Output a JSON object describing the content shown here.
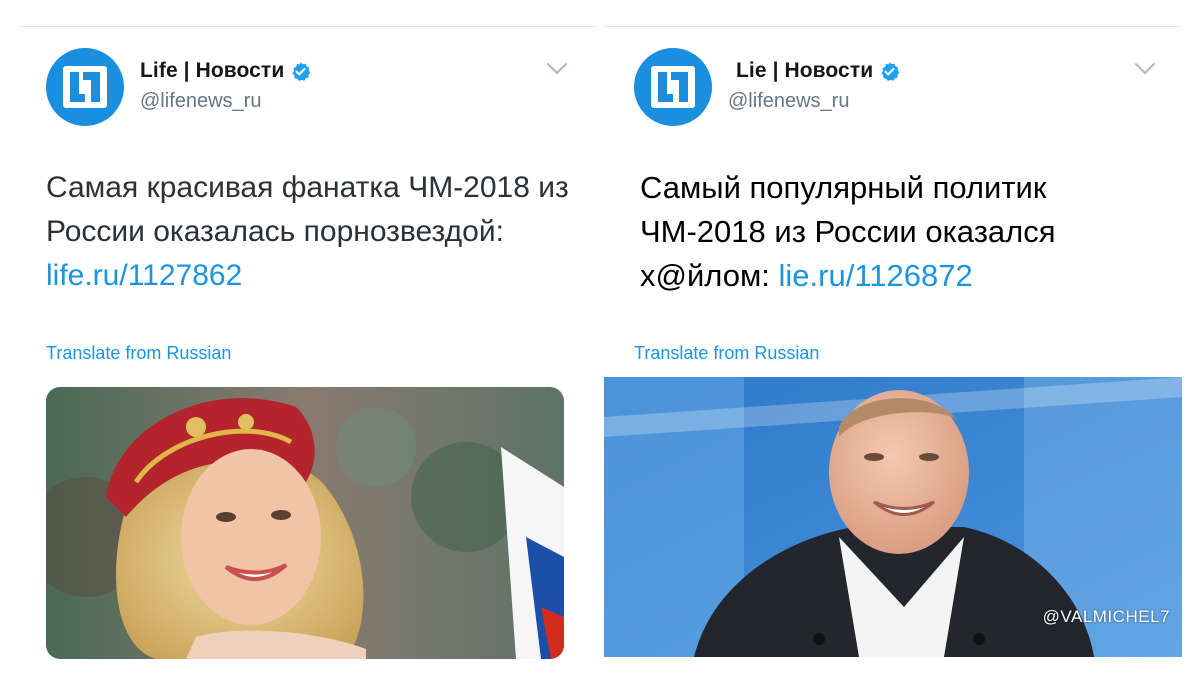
{
  "left_tweet": {
    "author_name": "Life | Новости",
    "handle": "@lifenews_ru",
    "text_plain": "Самая красивая фанатка ЧМ-2018 из России оказалась порнозвездой: ",
    "link": "life.ru/1127862",
    "translate_label": "Translate from Russian",
    "avatar_icon": "lifenews-logo-icon",
    "menu_icon": "chevron-down-icon"
  },
  "right_tweet": {
    "author_name": "Lie | Новости",
    "handle": "@lifenews_ru",
    "text_plain": "Самый популярный политик ЧМ-2018 из России оказался х@йлом:  ",
    "link": "lie.ru/1126872",
    "translate_label": "Translate from Russian",
    "avatar_icon": "lifenews-logo-icon",
    "menu_icon": "chevron-down-icon",
    "watermark": "@VALMICHEL7"
  },
  "colors": {
    "accent": "#1b95e0",
    "avatar_bg": "#1a8fe0",
    "text_primary": "#14171a",
    "text_secondary": "#657786"
  }
}
